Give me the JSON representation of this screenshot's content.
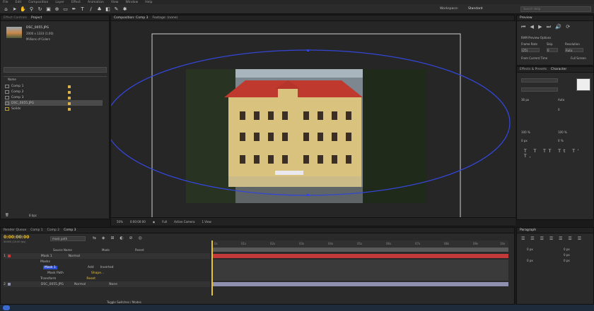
{
  "menu": [
    "File",
    "Edit",
    "Composition",
    "Layer",
    "Effect",
    "Animation",
    "View",
    "Window",
    "Help"
  ],
  "toolbar": {
    "workspace_label": "Workspace:",
    "workspace_value": "Standard",
    "search_placeholder": "Search Help"
  },
  "project": {
    "tab": "Project",
    "footage_name": "DSC_0055.JPG",
    "footage_info": "2000 x 1333 (1.00)",
    "footage_colors": "Millions of Colors",
    "col_name": "Name",
    "items": [
      {
        "label": "Comp 1"
      },
      {
        "label": "Comp 2"
      },
      {
        "label": "Comp 3"
      },
      {
        "label": "DSC_0055.JPG"
      },
      {
        "label": "Solids"
      }
    ],
    "bpc": "8 bpc"
  },
  "composition": {
    "tab": "Composition: Comp 3",
    "footage_tab": "Footage: (none)",
    "crumb": "Comp 3",
    "zoom": "50%",
    "timecode": "0:00:00:00",
    "res": "Full",
    "view": "Active Camera",
    "views": "1 View"
  },
  "preview": {
    "tab": "Preview",
    "ram_options": "RAM Preview Options",
    "frame_rate_label": "Frame Rate",
    "skip_label": "Skip",
    "resolution_label": "Resolution",
    "frame_rate": "(25)",
    "skip": "0",
    "resolution": "Auto",
    "from_current": "From Current Time",
    "full_screen": "Full Screen"
  },
  "character": {
    "tabs": [
      "Effects & Presets",
      "Character"
    ],
    "size": "36 px",
    "leading": "Auto",
    "tracking": "0",
    "scale_v": "100 %",
    "scale_h": "100 %",
    "baseline": "0 px",
    "tsume": "0 %"
  },
  "timeline": {
    "tabs": [
      "Render Queue",
      "Comp 1",
      "Comp 2",
      "Comp 3"
    ],
    "timecode": "0:00:00:00",
    "fps": "00000 (25.00 fps)",
    "col_source": "Source Name",
    "col_mode": "Mode",
    "col_parent": "Parent",
    "layers": [
      {
        "num": "1",
        "name": "Mask 1",
        "mode": "Normal"
      },
      {
        "num": "2",
        "name": "DSC_0055.JPG",
        "mode": "Normal"
      }
    ],
    "search_value": "mask path",
    "sub_masks": "Masks",
    "sub_mask1": "Mask 1",
    "mask_mode": "Add",
    "inverted": "Inverted",
    "mask_path": "Mask Path",
    "shape": "Shape...",
    "transform": "Transform",
    "reset": "Reset",
    "parent_none": "None",
    "ticks": [
      "0s",
      "01s",
      "02s",
      "03s",
      "04s",
      "05s",
      "06s",
      "07s",
      "08s",
      "09s",
      "10s"
    ],
    "switches": "Toggle Switches / Modes",
    "colors": {
      "layer1": "#c43a3a",
      "layer2": "#8f8fb0",
      "accent": "#e8c13a",
      "mask": "#2f4fd0"
    }
  },
  "paragraph": {
    "tab": "Paragraph",
    "indent_left": "0 px",
    "indent_right": "0 px",
    "indent_first": "0 px",
    "space_before": "0 px",
    "space_after": "0 px"
  }
}
